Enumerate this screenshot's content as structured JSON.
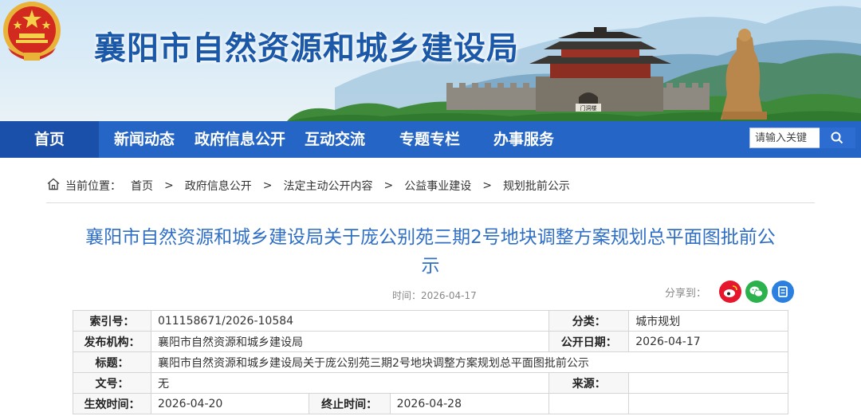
{
  "header": {
    "site_title": "襄阳市自然资源和城乡建设局",
    "emblem_icon": "national-emblem-icon",
    "gate_sign": "门洞楼"
  },
  "nav": {
    "items": [
      {
        "label": "首页",
        "active": true
      },
      {
        "label": "新闻动态"
      },
      {
        "label": "政府信息公开"
      },
      {
        "label": "互动交流"
      },
      {
        "label": "专题专栏"
      },
      {
        "label": "办事服务"
      }
    ],
    "search": {
      "placeholder": "请输入关键",
      "icon": "search-icon"
    },
    "color": "#2565c6"
  },
  "breadcrumb": {
    "prefix": "当前位置：",
    "items": [
      "首页",
      "政府信息公开",
      "法定主动公开内容",
      "公益事业建设",
      "规划批前公示"
    ],
    "separator": ">"
  },
  "article": {
    "title_line1": "襄阳市自然资源和城乡建设局关于庞公别苑三期2号地块调整方案规划总平面图批前公",
    "title_line2": "示",
    "time": "时间：2026-04-17",
    "share_label": "分享到：",
    "share_icons": [
      "weibo-icon",
      "wechat-icon",
      "qzone-icon"
    ],
    "title_color": "#2f6fc6"
  },
  "info_table": {
    "index_label": "索引号：",
    "index_value": "011158671/2026-10584",
    "category_label": "分类：",
    "category_value": "城市规划",
    "publisher_label": "发布机构：",
    "publisher_value": "襄阳市自然资源和城乡建设局",
    "date_label": "公开日期：",
    "date_value": "2026-04-17",
    "title_label": "标题：",
    "title_value": "襄阳市自然资源和城乡建设局关于庞公别苑三期2号地块调整方案规划总平面图批前公示",
    "docno_label": "文号：",
    "docno_value": "无",
    "source_label": "来源：",
    "source_value": "",
    "effective_label": "生效时间：",
    "effective_value": "2026-04-20",
    "end_label": "终止时间：",
    "end_value": "2026-04-28"
  }
}
